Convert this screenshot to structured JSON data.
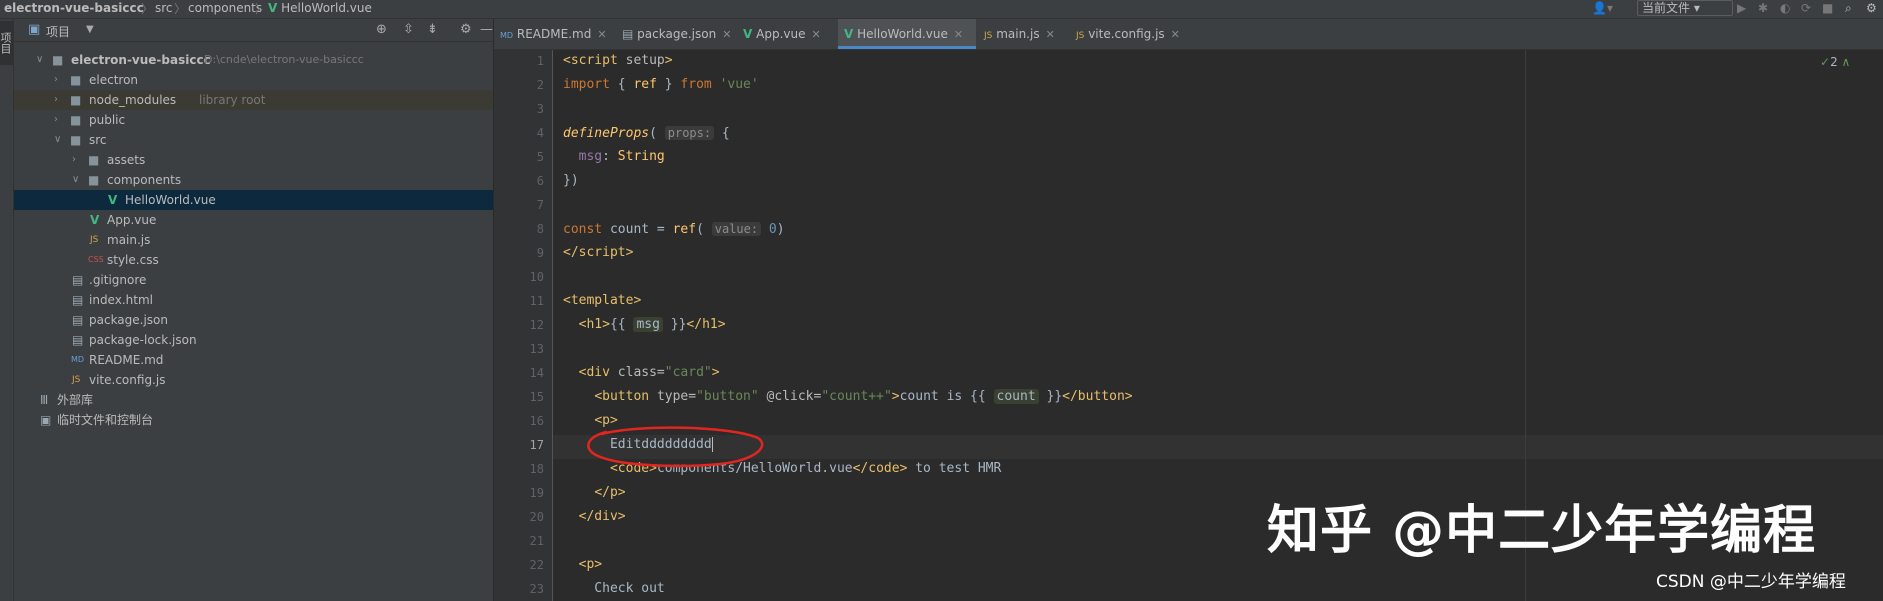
{
  "breadcrumb": {
    "project": "electron-vue-basiccc",
    "folder1": "src",
    "folder2": "components",
    "file": "HelloWorld.vue"
  },
  "toolbar": {
    "run_config": "当前文件",
    "run_config_arrow": "▾"
  },
  "project_panel": {
    "title": "项目",
    "strip_label": "项目",
    "tree": [
      {
        "label": "electron-vue-basiccc",
        "extra": "D:\\cnde\\electron-vue-basiccc",
        "arrow": "∨",
        "icon": "folder-icon"
      },
      {
        "label": "electron",
        "arrow": "›",
        "icon": "folder-icon"
      },
      {
        "label": "node_modules",
        "extra": "library root",
        "arrow": "›",
        "icon": "folder-icon"
      },
      {
        "label": "public",
        "arrow": "›",
        "icon": "folder-icon"
      },
      {
        "label": "src",
        "arrow": "∨",
        "icon": "folder-icon"
      },
      {
        "label": "assets",
        "arrow": "›",
        "icon": "folder-icon"
      },
      {
        "label": "components",
        "arrow": "∨",
        "icon": "folder-icon"
      },
      {
        "label": "HelloWorld.vue",
        "icon": "vue-file-icon"
      },
      {
        "label": "App.vue",
        "icon": "vue-file-icon"
      },
      {
        "label": "main.js",
        "icon": "js-file-icon"
      },
      {
        "label": "style.css",
        "icon": "css-file-icon"
      },
      {
        "label": ".gitignore",
        "icon": "text-file-icon"
      },
      {
        "label": "index.html",
        "icon": "html-file-icon"
      },
      {
        "label": "package.json",
        "icon": "json-file-icon"
      },
      {
        "label": "package-lock.json",
        "icon": "json-file-icon"
      },
      {
        "label": "README.md",
        "icon": "md-file-icon"
      },
      {
        "label": "vite.config.js",
        "icon": "js-file-icon"
      },
      {
        "label": "外部库",
        "icon": "library-icon"
      },
      {
        "label": "临时文件和控制台",
        "icon": "console-icon"
      }
    ]
  },
  "tabs": [
    {
      "label": "README.md",
      "icon": "md-file-icon",
      "active": false
    },
    {
      "label": "package.json",
      "icon": "json-file-icon",
      "active": false
    },
    {
      "label": "App.vue",
      "icon": "vue-file-icon",
      "active": false
    },
    {
      "label": "HelloWorld.vue",
      "icon": "vue-file-icon",
      "active": true
    },
    {
      "label": "main.js",
      "icon": "js-file-icon",
      "active": false
    },
    {
      "label": "vite.config.js",
      "icon": "js-file-icon",
      "active": false
    }
  ],
  "editor": {
    "current_line": 17,
    "inspection_count": "2",
    "line_numbers": [
      "1",
      "2",
      "3",
      "4",
      "5",
      "6",
      "7",
      "8",
      "9",
      "10",
      "11",
      "12",
      "13",
      "14",
      "15",
      "16",
      "17",
      "18",
      "19",
      "20",
      "21",
      "22",
      "23"
    ],
    "hints": {
      "props": "props:",
      "value": "value:"
    },
    "edited_text": "Editddddddddd"
  },
  "watermark": {
    "main": "知乎 @中二少年学编程",
    "csdn": "CSDN @中二少年学编程"
  }
}
